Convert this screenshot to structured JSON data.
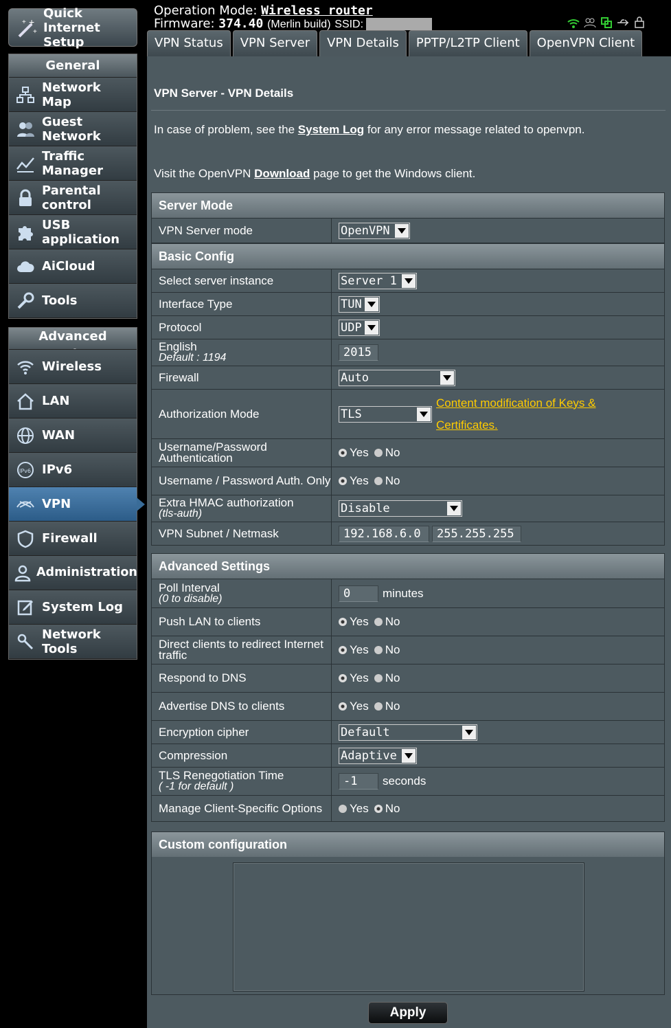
{
  "header": {
    "operation_mode_label": "Operation Mode:",
    "operation_mode_value": "Wireless router",
    "firmware_label": "Firmware:",
    "firmware_value": "374.40",
    "build_note": "(Merlin build)",
    "ssid_label": "SSID:"
  },
  "tabs": [
    {
      "label": "VPN Status"
    },
    {
      "label": "VPN Server"
    },
    {
      "label": "VPN Details"
    },
    {
      "label": "PPTP/L2TP Client"
    },
    {
      "label": "OpenVPN Client"
    }
  ],
  "sidebar": {
    "quick_setup": "Quick Internet Setup",
    "general_title": "General",
    "general_items": [
      {
        "label": "Network Map"
      },
      {
        "label": "Guest Network"
      },
      {
        "label": "Traffic Manager"
      },
      {
        "label": "Parental control"
      },
      {
        "label": "USB application"
      },
      {
        "label": "AiCloud"
      },
      {
        "label": "Tools"
      }
    ],
    "advanced_title": "Advanced Settings",
    "advanced_items": [
      {
        "label": "Wireless"
      },
      {
        "label": "LAN"
      },
      {
        "label": "WAN"
      },
      {
        "label": "IPv6"
      },
      {
        "label": "VPN"
      },
      {
        "label": "Firewall"
      },
      {
        "label": "Administration"
      },
      {
        "label": "System Log"
      },
      {
        "label": "Network Tools"
      }
    ]
  },
  "page": {
    "title": "VPN Server - VPN Details",
    "problem_pre": "In case of problem, see the ",
    "problem_link": "System Log",
    "problem_post": " for any error message related to openvpn.",
    "visit_pre": "Visit the OpenVPN ",
    "visit_link": "Download",
    "visit_post": " page to get the Windows client."
  },
  "server_mode": {
    "title": "Server Mode",
    "vpn_server_mode_label": "VPN Server mode",
    "vpn_server_mode_value": "OpenVPN"
  },
  "basic": {
    "title": "Basic Config",
    "instance_label": "Select server instance",
    "instance_value": "Server 1",
    "iface_label": "Interface Type",
    "iface_value": "TUN",
    "protocol_label": "Protocol",
    "protocol_value": "UDP",
    "port_label": "English",
    "port_sub": "Default : 1194",
    "port_value": "2015",
    "firewall_label": "Firewall",
    "firewall_value": "Auto",
    "auth_label": "Authorization Mode",
    "auth_value": "TLS",
    "auth_link": "Content modification of Keys & Certificates.",
    "userpass_label": "Username/Password Authentication",
    "userpass_only_label": "Username / Password Auth. Only",
    "hmac_label": "Extra HMAC authorization",
    "hmac_sub": "(tls-auth)",
    "hmac_value": "Disable",
    "subnet_label": "VPN Subnet / Netmask",
    "subnet_value": "192.168.6.0",
    "netmask_value": "255.255.255"
  },
  "advanced": {
    "title": "Advanced Settings",
    "poll_label": "Poll Interval",
    "poll_sub": "(0 to disable)",
    "poll_value": "0",
    "poll_unit": "minutes",
    "push_lan_label": "Push LAN to clients",
    "redirect_label": "Direct clients to redirect Internet traffic",
    "dns_label": "Respond to DNS",
    "adv_dns_label": "Advertise DNS to clients",
    "cipher_label": "Encryption cipher",
    "cipher_value": "Default",
    "compression_label": "Compression",
    "compression_value": "Adaptive",
    "tls_label": "TLS Renegotiation Time",
    "tls_sub": "( -1 for default )",
    "tls_value": "-1",
    "tls_unit": "seconds",
    "ccd_label": "Manage Client-Specific Options"
  },
  "radio": {
    "yes": "Yes",
    "no": "No"
  },
  "custom": {
    "title": "Custom configuration"
  },
  "apply_label": "Apply"
}
